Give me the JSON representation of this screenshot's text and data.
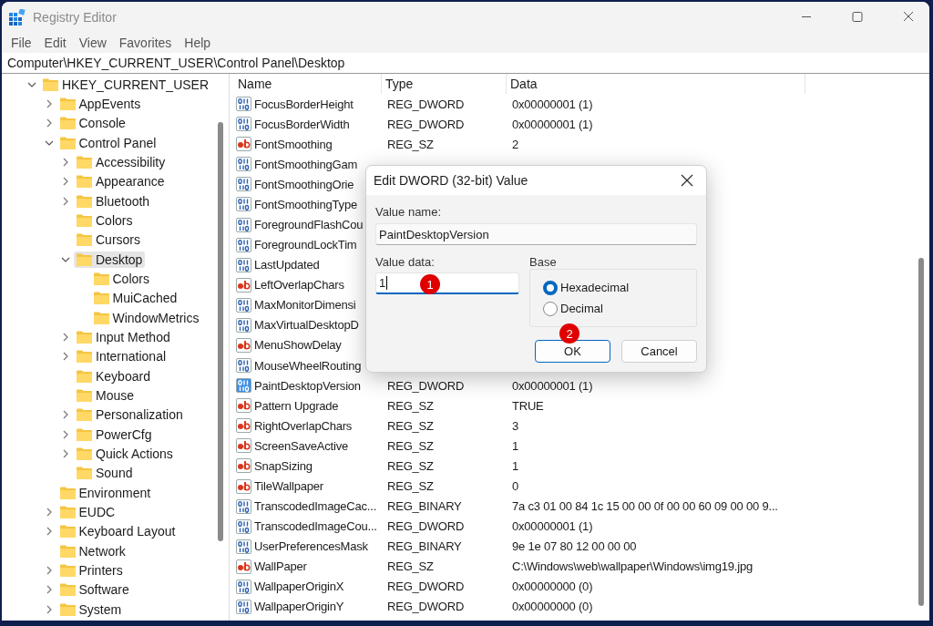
{
  "window": {
    "title": "Registry Editor"
  },
  "menu": [
    "File",
    "Edit",
    "View",
    "Favorites",
    "Help"
  ],
  "address": "Computer\\HKEY_CURRENT_USER\\Control Panel\\Desktop",
  "tree": [
    {
      "label": "HKEY_CURRENT_USER",
      "expanded": true,
      "selected": false,
      "children": [
        {
          "label": "AppEvents",
          "expanded": false,
          "selected": false
        },
        {
          "label": "Console",
          "expanded": false,
          "selected": false
        },
        {
          "label": "Control Panel",
          "expanded": true,
          "selected": false,
          "children": [
            {
              "label": "Accessibility",
              "expanded": false,
              "selected": false
            },
            {
              "label": "Appearance",
              "expanded": false,
              "selected": false
            },
            {
              "label": "Bluetooth",
              "expanded": false,
              "selected": false
            },
            {
              "label": "Colors",
              "selected": false
            },
            {
              "label": "Cursors",
              "selected": false
            },
            {
              "label": "Desktop",
              "expanded": true,
              "selected": true,
              "children": [
                {
                  "label": "Colors",
                  "selected": false
                },
                {
                  "label": "MuiCached",
                  "selected": false
                },
                {
                  "label": "WindowMetrics",
                  "selected": false
                }
              ]
            },
            {
              "label": "Input Method",
              "expanded": false,
              "selected": false
            },
            {
              "label": "International",
              "expanded": false,
              "selected": false
            },
            {
              "label": "Keyboard",
              "selected": false
            },
            {
              "label": "Mouse",
              "selected": false
            },
            {
              "label": "Personalization",
              "expanded": false,
              "selected": false
            },
            {
              "label": "PowerCfg",
              "expanded": false,
              "selected": false
            },
            {
              "label": "Quick Actions",
              "expanded": false,
              "selected": false
            },
            {
              "label": "Sound",
              "selected": false
            }
          ]
        },
        {
          "label": "Environment",
          "selected": false
        },
        {
          "label": "EUDC",
          "expanded": false,
          "selected": false
        },
        {
          "label": "Keyboard Layout",
          "expanded": false,
          "selected": false
        },
        {
          "label": "Network",
          "selected": false
        },
        {
          "label": "Printers",
          "expanded": false,
          "selected": false
        },
        {
          "label": "Software",
          "expanded": false,
          "selected": false
        },
        {
          "label": "System",
          "expanded": false,
          "selected": false
        }
      ]
    }
  ],
  "table": {
    "columns": [
      "Name",
      "Type",
      "Data"
    ],
    "rows": [
      {
        "kind": "binary",
        "name": "FocusBorderHeight",
        "type": "REG_DWORD",
        "data": "0x00000001 (1)",
        "selected": false
      },
      {
        "kind": "binary",
        "name": "FocusBorderWidth",
        "type": "REG_DWORD",
        "data": "0x00000001 (1)",
        "selected": false
      },
      {
        "kind": "string",
        "name": "FontSmoothing",
        "type": "REG_SZ",
        "data": "2",
        "selected": false
      },
      {
        "kind": "binary",
        "name": "FontSmoothingGam",
        "selected": false
      },
      {
        "kind": "binary",
        "name": "FontSmoothingOrie",
        "selected": false
      },
      {
        "kind": "binary",
        "name": "FontSmoothingType",
        "selected": false
      },
      {
        "kind": "binary",
        "name": "ForegroundFlashCou",
        "selected": false
      },
      {
        "kind": "binary",
        "name": "ForegroundLockTim",
        "selected": false
      },
      {
        "kind": "binary",
        "name": "LastUpdated",
        "selected": false
      },
      {
        "kind": "string",
        "name": "LeftOverlapChars",
        "selected": false
      },
      {
        "kind": "binary",
        "name": "MaxMonitorDimensi",
        "selected": false
      },
      {
        "kind": "binary",
        "name": "MaxVirtualDesktopD",
        "selected": false
      },
      {
        "kind": "string",
        "name": "MenuShowDelay",
        "selected": false
      },
      {
        "kind": "binary",
        "name": "MouseWheelRouting",
        "selected": false
      },
      {
        "kind": "binary",
        "name": "PaintDesktopVersion",
        "type": "REG_DWORD",
        "data": "0x00000001 (1)",
        "selected": true
      },
      {
        "kind": "string",
        "name": "Pattern Upgrade",
        "type": "REG_SZ",
        "data": "TRUE",
        "selected": false
      },
      {
        "kind": "string",
        "name": "RightOverlapChars",
        "type": "REG_SZ",
        "data": "3",
        "selected": false
      },
      {
        "kind": "string",
        "name": "ScreenSaveActive",
        "type": "REG_SZ",
        "data": "1",
        "selected": false
      },
      {
        "kind": "string",
        "name": "SnapSizing",
        "type": "REG_SZ",
        "data": "1",
        "selected": false
      },
      {
        "kind": "string",
        "name": "TileWallpaper",
        "type": "REG_SZ",
        "data": "0",
        "selected": false
      },
      {
        "kind": "binary",
        "name": "TranscodedImageCac...",
        "type": "REG_BINARY",
        "data": "7a c3 01 00 84 1c 15 00 00 0f 00 00 60 09 00 00 9...",
        "selected": false
      },
      {
        "kind": "binary",
        "name": "TranscodedImageCou...",
        "type": "REG_DWORD",
        "data": "0x00000001 (1)",
        "selected": false
      },
      {
        "kind": "binary",
        "name": "UserPreferencesMask",
        "type": "REG_BINARY",
        "data": "9e 1e 07 80 12 00 00 00",
        "selected": false
      },
      {
        "kind": "string",
        "name": "WallPaper",
        "type": "REG_SZ",
        "data": "C:\\Windows\\web\\wallpaper\\Windows\\img19.jpg",
        "selected": false
      },
      {
        "kind": "binary",
        "name": "WallpaperOriginX",
        "type": "REG_DWORD",
        "data": "0x00000000 (0)",
        "selected": false
      },
      {
        "kind": "binary",
        "name": "WallpaperOriginY",
        "type": "REG_DWORD",
        "data": "0x00000000 (0)",
        "selected": false
      }
    ]
  },
  "dialog": {
    "title": "Edit DWORD (32-bit) Value",
    "value_name": {
      "label": "Value name:",
      "value": "PaintDesktopVersion"
    },
    "value_data": {
      "label": "Value data:",
      "value": "1",
      "focused": true,
      "badge": "1"
    },
    "base": {
      "label": "Base",
      "options": [
        {
          "label": "Hexadecimal",
          "selected": true
        },
        {
          "label": "Decimal",
          "selected": false
        }
      ]
    },
    "buttons": [
      {
        "label": "OK",
        "default": true,
        "badge": "2"
      },
      {
        "label": "Cancel",
        "default": false
      }
    ]
  }
}
